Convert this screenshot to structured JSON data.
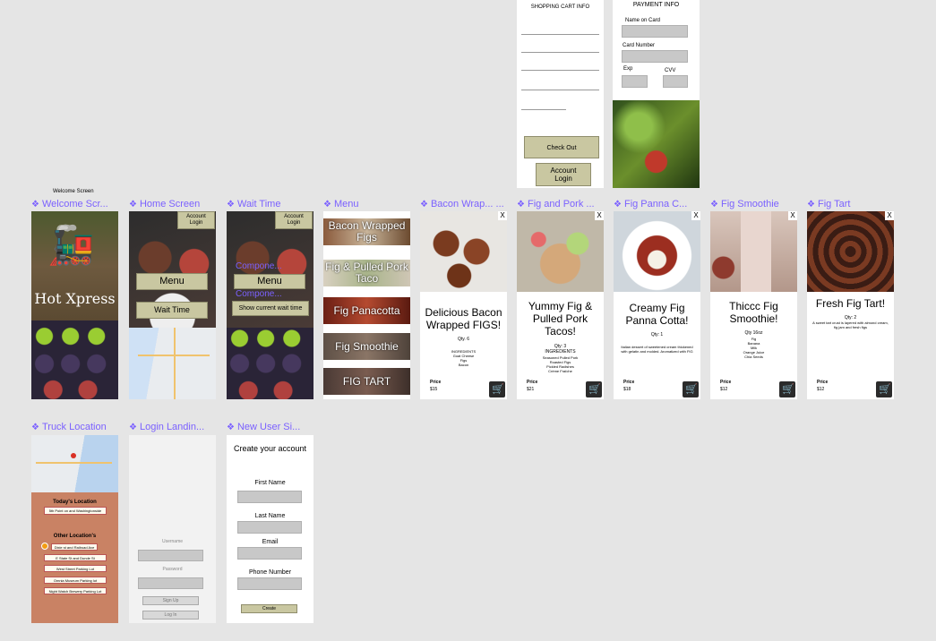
{
  "frames": {
    "welcome": "Welcome Scr...",
    "home": "Home Screen",
    "wait": "Wait Time",
    "menu": "Menu",
    "bacon": "Bacon Wrap... ...",
    "figpork": "Fig and Pork ...",
    "panna": "Fig Panna C...",
    "smoothie": "Fig Smoothie",
    "tart": "Fig Tart",
    "truck": "Truck Location",
    "login": "Login Landin...",
    "newuser": "New User Si..."
  },
  "welcome_screen_label": "Welcome Screen",
  "welcome": {
    "brand": "Hot Xpress"
  },
  "home": {
    "account_login": "Account\nLogin",
    "menu": "Menu",
    "wait_time": "Wait Time"
  },
  "wait": {
    "account_login": "Account\nLogin",
    "menu": "Menu",
    "component1": "Compone...",
    "component2": "Compone...",
    "show_wait": "Show current wait time"
  },
  "menu_items": [
    "Bacon Wrapped Figs",
    "Fig & Pulled Pork Taco",
    "Fig Panacotta",
    "Fig Smoothie",
    "FIG TART"
  ],
  "cart": {
    "title": "SHOPPING CART INFO",
    "checkout": "Check Out",
    "account_login": "Account\nLogin"
  },
  "payment": {
    "title": "PAYMENT INFO",
    "name_label": "Name on Card",
    "card_label": "Card Number",
    "exp_label": "Exp",
    "cvv_label": "CVV"
  },
  "bacon": {
    "title": "Delicious Bacon Wrapped FIGS!",
    "qty": "Qty. 6",
    "ingredients_head": "INGREDIENTS",
    "ingredients": "Goat Cheese\nFigs\nBacon",
    "price_label": "Price",
    "price": "$15",
    "close": "X"
  },
  "figpork": {
    "title": "Yummy Fig & Pulled Pork Tacos!",
    "qty": "Qty: 3",
    "ingredients_head": "INGREDIENTS",
    "ingredients": "Seasoned Pulled Pork\nRoasted Figs\nPickled Radishes\nCrème Fraîche",
    "price_label": "Price",
    "price": "$21",
    "close": "X"
  },
  "panna": {
    "title": "Creamy Fig Panna Cotta!",
    "qty": "Qty: 1",
    "desc": "Italian dessert of sweetened cream thickened with gelatin and molded. Aromatized with FIG",
    "price_label": "Price",
    "price": "$18",
    "close": "X"
  },
  "smoothie": {
    "title": "Thiccc Fig Smoothie!",
    "qty": "Qty 16oz",
    "ingredients": "Fig\nBanana\nMilk\nOrange Juice\nChia Seeds",
    "price_label": "Price",
    "price": "$12",
    "close": "X"
  },
  "tart": {
    "title": "Fresh Fig Tart!",
    "qty": "Qty: 2",
    "desc": "A sweet tart crust is layered with almond cream, fig jam and fresh figs",
    "price_label": "Price",
    "price": "$12",
    "close": "X"
  },
  "truck": {
    "today_head": "Today's Location",
    "today": "5th Point on and Washingtonside",
    "other_head": "Other Location's",
    "others": [
      "Dixie st and Railroad Ave",
      "E State St and Dunde St",
      "West Street Parking Lot",
      "Omnia Museum Parking lot",
      "Night Watch Brewery Parking Lot"
    ]
  },
  "login": {
    "username": "Username",
    "password": "Password",
    "signup": "Sign Up",
    "login": "Log In"
  },
  "newuser": {
    "title": "Create your account",
    "first": "First Name",
    "last": "Last Name",
    "email": "Email",
    "phone": "Phone Number",
    "create": "Create"
  },
  "colors": {
    "olive": "#c9c7a1",
    "accent": "#7b61ff",
    "terracotta": "#c98264"
  }
}
